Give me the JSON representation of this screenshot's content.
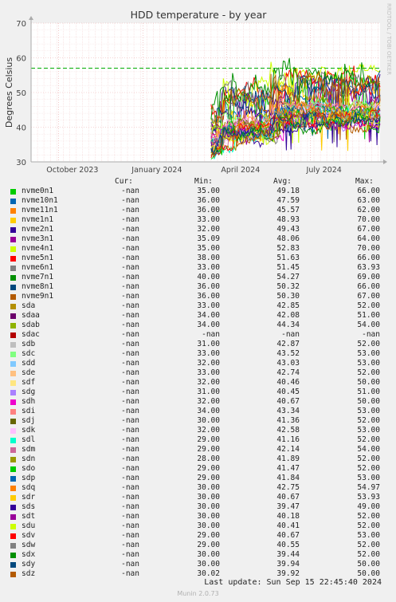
{
  "chart_data": {
    "type": "line",
    "title": "HDD temperature - by year",
    "ylabel": "Degrees Celsius",
    "side_label": "RRDTOOL / TOBI OETIKER",
    "ylim": [
      30,
      70
    ],
    "yticks": [
      30,
      40,
      50,
      60,
      70
    ],
    "x_tick_labels": [
      "October 2023",
      "January 2024",
      "April 2024",
      "July 2024"
    ],
    "x_range": [
      "2023-09-01",
      "2024-09-15"
    ],
    "x_ticks": [
      "2023-10-01",
      "2024-01-01",
      "2024-04-01",
      "2024-07-01"
    ],
    "data_start": "2024-03-15",
    "warning_line": 57,
    "grid": true
  },
  "legend": {
    "headers": {
      "cur": "Cur:",
      "min": "Min:",
      "avg": "Avg:",
      "max": "Max:"
    },
    "series": [
      {
        "name": "nvme0n1",
        "color": "#00cc00",
        "cur": "-nan",
        "min": "35.00",
        "avg": "49.18",
        "max": "66.00"
      },
      {
        "name": "nvme10n1",
        "color": "#0066b3",
        "cur": "-nan",
        "min": "36.00",
        "avg": "47.59",
        "max": "63.00"
      },
      {
        "name": "nvme11n1",
        "color": "#ff8000",
        "cur": "-nan",
        "min": "36.00",
        "avg": "45.57",
        "max": "62.00"
      },
      {
        "name": "nvme1n1",
        "color": "#ffcc00",
        "cur": "-nan",
        "min": "33.00",
        "avg": "48.93",
        "max": "70.00"
      },
      {
        "name": "nvme2n1",
        "color": "#330099",
        "cur": "-nan",
        "min": "32.00",
        "avg": "49.43",
        "max": "67.00"
      },
      {
        "name": "nvme3n1",
        "color": "#990099",
        "cur": "-nan",
        "min": "35.09",
        "avg": "48.06",
        "max": "64.00"
      },
      {
        "name": "nvme4n1",
        "color": "#ccff00",
        "cur": "-nan",
        "min": "35.00",
        "avg": "52.83",
        "max": "70.00"
      },
      {
        "name": "nvme5n1",
        "color": "#ff0000",
        "cur": "-nan",
        "min": "38.00",
        "avg": "51.63",
        "max": "66.00"
      },
      {
        "name": "nvme6n1",
        "color": "#808080",
        "cur": "-nan",
        "min": "33.00",
        "avg": "51.45",
        "max": "63.93"
      },
      {
        "name": "nvme7n1",
        "color": "#008f00",
        "cur": "-nan",
        "min": "40.00",
        "avg": "54.27",
        "max": "69.00"
      },
      {
        "name": "nvme8n1",
        "color": "#00487d",
        "cur": "-nan",
        "min": "36.00",
        "avg": "50.32",
        "max": "66.00"
      },
      {
        "name": "nvme9n1",
        "color": "#b35a00",
        "cur": "-nan",
        "min": "36.00",
        "avg": "50.30",
        "max": "67.00"
      },
      {
        "name": "sda",
        "color": "#b38f00",
        "cur": "-nan",
        "min": "33.00",
        "avg": "42.85",
        "max": "52.00"
      },
      {
        "name": "sdaa",
        "color": "#6b006b",
        "cur": "-nan",
        "min": "34.00",
        "avg": "42.08",
        "max": "51.00"
      },
      {
        "name": "sdab",
        "color": "#8fb300",
        "cur": "-nan",
        "min": "34.00",
        "avg": "44.34",
        "max": "54.00"
      },
      {
        "name": "sdac",
        "color": "#b30000",
        "cur": "-nan",
        "min": "-nan",
        "avg": "-nan",
        "max": "-nan"
      },
      {
        "name": "sdb",
        "color": "#bebebe",
        "cur": "-nan",
        "min": "31.00",
        "avg": "42.87",
        "max": "52.00"
      },
      {
        "name": "sdc",
        "color": "#80ff80",
        "cur": "-nan",
        "min": "33.00",
        "avg": "43.52",
        "max": "53.00"
      },
      {
        "name": "sdd",
        "color": "#80c9ff",
        "cur": "-nan",
        "min": "32.00",
        "avg": "43.03",
        "max": "53.00"
      },
      {
        "name": "sde",
        "color": "#ffc080",
        "cur": "-nan",
        "min": "33.00",
        "avg": "42.74",
        "max": "52.00"
      },
      {
        "name": "sdf",
        "color": "#ffe680",
        "cur": "-nan",
        "min": "32.00",
        "avg": "40.46",
        "max": "50.00"
      },
      {
        "name": "sdg",
        "color": "#aa80ff",
        "cur": "-nan",
        "min": "31.00",
        "avg": "40.45",
        "max": "51.00"
      },
      {
        "name": "sdh",
        "color": "#ee00cc",
        "cur": "-nan",
        "min": "32.00",
        "avg": "40.67",
        "max": "50.00"
      },
      {
        "name": "sdi",
        "color": "#ff8080",
        "cur": "-nan",
        "min": "34.00",
        "avg": "43.34",
        "max": "53.00"
      },
      {
        "name": "sdj",
        "color": "#666600",
        "cur": "-nan",
        "min": "30.00",
        "avg": "41.36",
        "max": "52.00"
      },
      {
        "name": "sdk",
        "color": "#ffbfff",
        "cur": "-nan",
        "min": "32.00",
        "avg": "42.58",
        "max": "53.00"
      },
      {
        "name": "sdl",
        "color": "#00ffcc",
        "cur": "-nan",
        "min": "29.00",
        "avg": "41.16",
        "max": "52.00"
      },
      {
        "name": "sdm",
        "color": "#cc6699",
        "cur": "-nan",
        "min": "29.00",
        "avg": "42.14",
        "max": "54.00"
      },
      {
        "name": "sdn",
        "color": "#999900",
        "cur": "-nan",
        "min": "28.00",
        "avg": "41.89",
        "max": "52.00"
      },
      {
        "name": "sdo",
        "color": "#00cc00",
        "cur": "-nan",
        "min": "29.00",
        "avg": "41.47",
        "max": "52.00"
      },
      {
        "name": "sdp",
        "color": "#0066b3",
        "cur": "-nan",
        "min": "29.00",
        "avg": "41.84",
        "max": "53.00"
      },
      {
        "name": "sdq",
        "color": "#ff8000",
        "cur": "-nan",
        "min": "30.00",
        "avg": "42.75",
        "max": "54.97"
      },
      {
        "name": "sdr",
        "color": "#ffcc00",
        "cur": "-nan",
        "min": "30.00",
        "avg": "40.67",
        "max": "53.93"
      },
      {
        "name": "sds",
        "color": "#330099",
        "cur": "-nan",
        "min": "30.00",
        "avg": "39.47",
        "max": "49.00"
      },
      {
        "name": "sdt",
        "color": "#990099",
        "cur": "-nan",
        "min": "30.00",
        "avg": "40.18",
        "max": "52.00"
      },
      {
        "name": "sdu",
        "color": "#ccff00",
        "cur": "-nan",
        "min": "30.00",
        "avg": "40.41",
        "max": "52.00"
      },
      {
        "name": "sdv",
        "color": "#ff0000",
        "cur": "-nan",
        "min": "29.00",
        "avg": "40.67",
        "max": "53.00"
      },
      {
        "name": "sdw",
        "color": "#808080",
        "cur": "-nan",
        "min": "29.00",
        "avg": "40.55",
        "max": "52.00"
      },
      {
        "name": "sdx",
        "color": "#008f00",
        "cur": "-nan",
        "min": "30.00",
        "avg": "39.44",
        "max": "52.00"
      },
      {
        "name": "sdy",
        "color": "#00487d",
        "cur": "-nan",
        "min": "30.00",
        "avg": "39.94",
        "max": "50.00"
      },
      {
        "name": "sdz",
        "color": "#b35a00",
        "cur": "-nan",
        "min": "30.02",
        "avg": "39.92",
        "max": "50.00"
      }
    ]
  },
  "footer": {
    "last_update": "Last update: Sun Sep 15 22:45:40 2024",
    "version": "Munin 2.0.73"
  }
}
